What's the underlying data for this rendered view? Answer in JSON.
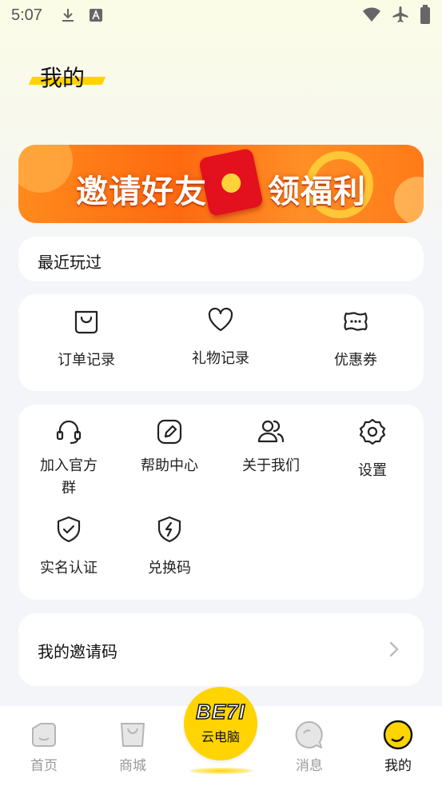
{
  "status_bar": {
    "time": "5:07",
    "icons": [
      "download-icon",
      "a-badge-icon",
      "wifi-icon",
      "airplane-icon",
      "battery-icon"
    ]
  },
  "header": {
    "title": "我的"
  },
  "banner": {
    "left_text": "邀请好友",
    "right_text": "领福利"
  },
  "recent": {
    "label": "最近玩过"
  },
  "records": {
    "items": [
      {
        "label": "订单记录",
        "icon": "shopping-bag-icon"
      },
      {
        "label": "礼物记录",
        "icon": "heart-icon"
      },
      {
        "label": "优惠券",
        "icon": "coupon-icon"
      }
    ]
  },
  "services": {
    "items": [
      {
        "label": "加入官方群",
        "icon": "headset-icon"
      },
      {
        "label": "帮助中心",
        "icon": "edit-icon"
      },
      {
        "label": "关于我们",
        "icon": "users-icon"
      },
      {
        "label": "设置",
        "icon": "gear-icon"
      },
      {
        "label": "实名认证",
        "icon": "shield-check-icon"
      },
      {
        "label": "兑换码",
        "icon": "shield-bolt-icon"
      }
    ]
  },
  "invite": {
    "label": "我的邀请码"
  },
  "tabbar": {
    "tabs": [
      {
        "label": "首页",
        "icon": "home-icon"
      },
      {
        "label": "商城",
        "icon": "store-icon"
      },
      {
        "label": "云电脑",
        "icon": "cloud-pc-logo",
        "logo_text": "BE7I"
      },
      {
        "label": "消息",
        "icon": "message-icon"
      },
      {
        "label": "我的",
        "icon": "profile-icon"
      }
    ],
    "active": "我的"
  },
  "colors": {
    "accent": "#ffd400",
    "banner": "#ff7a18",
    "text": "#111111",
    "inactive": "#999999"
  }
}
